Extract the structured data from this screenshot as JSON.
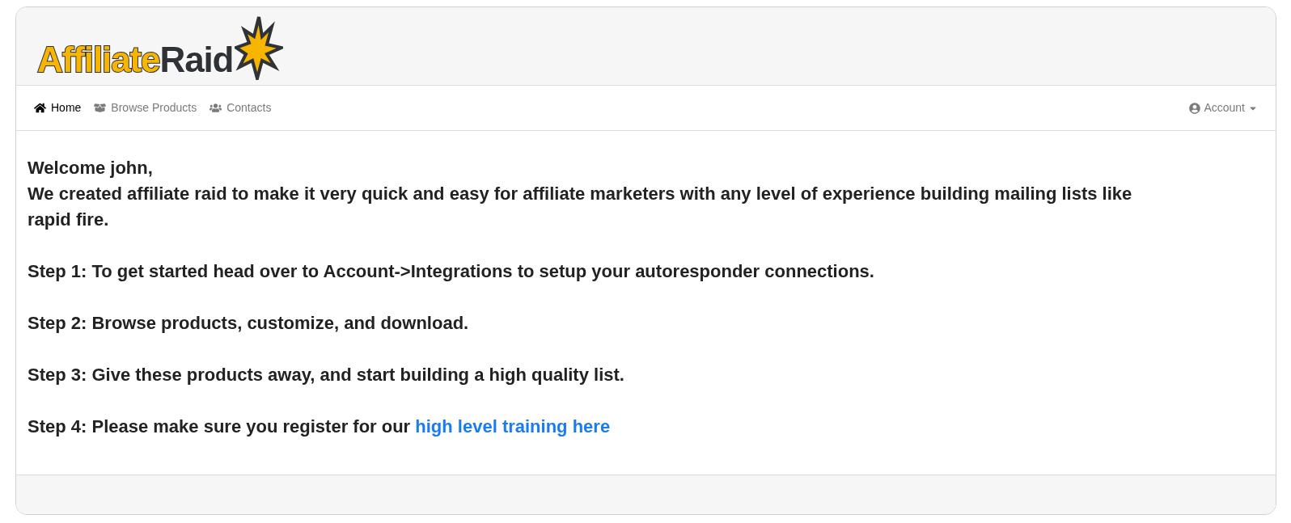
{
  "logo": {
    "first": "Affiliate",
    "second": "Raid"
  },
  "nav": {
    "items": [
      {
        "label": "Home",
        "kind": "home",
        "selected": true
      },
      {
        "label": "Browse Products",
        "kind": "box",
        "selected": false
      },
      {
        "label": "Contacts",
        "kind": "users",
        "selected": false
      }
    ],
    "account": "Account"
  },
  "content": {
    "welcome": "Welcome john,",
    "intro": "We created affiliate raid to make it very quick and easy for affiliate marketers with any level of experience building mailing lists like rapid fire.",
    "steps": [
      {
        "text": "Step 1: To get started head over to Account->Integrations to setup your autoresponder connections."
      },
      {
        "text": "Step 2: Browse products, customize, and download."
      },
      {
        "text": "Step 3: Give these products away, and start building a high quality list."
      },
      {
        "text": "Step 4: Please make sure you register for our ",
        "link": "high level training here"
      }
    ]
  }
}
